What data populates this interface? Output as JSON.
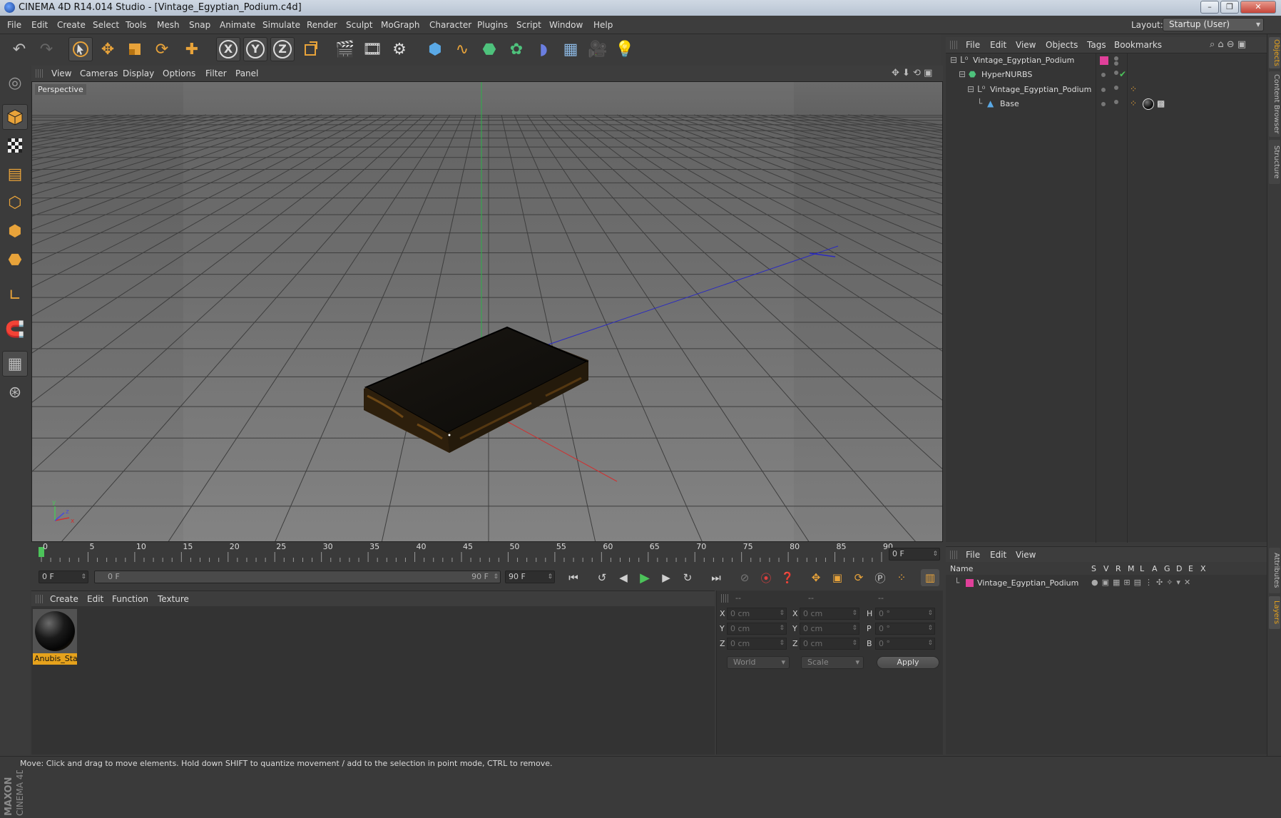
{
  "window": {
    "title": "CINEMA 4D R14.014 Studio - [Vintage_Egyptian_Podium.c4d]"
  },
  "menubar": {
    "items": [
      "File",
      "Edit",
      "Create",
      "Select",
      "Tools",
      "Mesh",
      "Snap",
      "Animate",
      "Simulate",
      "Render",
      "Sculpt",
      "MoGraph",
      "Character",
      "Plugins",
      "Script",
      "Window",
      "Help"
    ],
    "layout_label": "Layout:",
    "layout_value": "Startup (User)"
  },
  "viewport": {
    "menu": [
      "View",
      "Cameras",
      "Display",
      "Options",
      "Filter",
      "Panel"
    ],
    "camera_label": "Perspective"
  },
  "timeline": {
    "ticks": [
      "0",
      "5",
      "10",
      "15",
      "20",
      "25",
      "30",
      "35",
      "40",
      "45",
      "50",
      "55",
      "60",
      "65",
      "70",
      "75",
      "80",
      "85",
      "90"
    ],
    "current_frame": "0 F",
    "start_frame": "0 F",
    "range_start": "0 F",
    "range_end": "90 F",
    "end_frame": "90 F"
  },
  "material_manager": {
    "menu": [
      "Create",
      "Edit",
      "Function",
      "Texture"
    ],
    "materials": [
      {
        "name": "Anubis_Sta"
      }
    ]
  },
  "coordinates": {
    "header": [
      "--",
      "--",
      "--"
    ],
    "rows": [
      {
        "pos_label": "X",
        "pos": "0 cm",
        "size_label": "X",
        "size": "0 cm",
        "rot_label": "H",
        "rot": "0 °"
      },
      {
        "pos_label": "Y",
        "pos": "0 cm",
        "size_label": "Y",
        "size": "0 cm",
        "rot_label": "P",
        "rot": "0 °"
      },
      {
        "pos_label": "Z",
        "pos": "0 cm",
        "size_label": "Z",
        "size": "0 cm",
        "rot_label": "B",
        "rot": "0 °"
      }
    ],
    "space": "World",
    "mode": "Scale",
    "apply": "Apply"
  },
  "object_manager": {
    "menu": [
      "File",
      "Edit",
      "View",
      "Objects",
      "Tags",
      "Bookmarks"
    ],
    "objects": [
      {
        "name": "Vintage_Egyptian_Podium"
      },
      {
        "name": "HyperNURBS"
      },
      {
        "name": "Vintage_Egyptian_Podium"
      },
      {
        "name": "Base"
      }
    ]
  },
  "layer_manager": {
    "menu": [
      "File",
      "Edit",
      "View"
    ],
    "columns": [
      "Name",
      "S",
      "V",
      "R",
      "M",
      "L",
      "A",
      "G",
      "D",
      "E",
      "X"
    ],
    "layers": [
      {
        "name": "Vintage_Egyptian_Podium",
        "color": "#e0409a"
      }
    ]
  },
  "right_tabs": [
    "Objects",
    "Content Browser",
    "Structure",
    "Attributes",
    "Layers"
  ],
  "status": {
    "text": "Move: Click and drag to move elements. Hold down SHIFT to quantize movement / add to the selection in point mode, CTRL to remove."
  },
  "logo": {
    "text": "MAXON CINEMA 4D"
  },
  "colors": {
    "accent": "#e8a33a",
    "selection": "#e6a21c",
    "layer": "#e0409a"
  }
}
